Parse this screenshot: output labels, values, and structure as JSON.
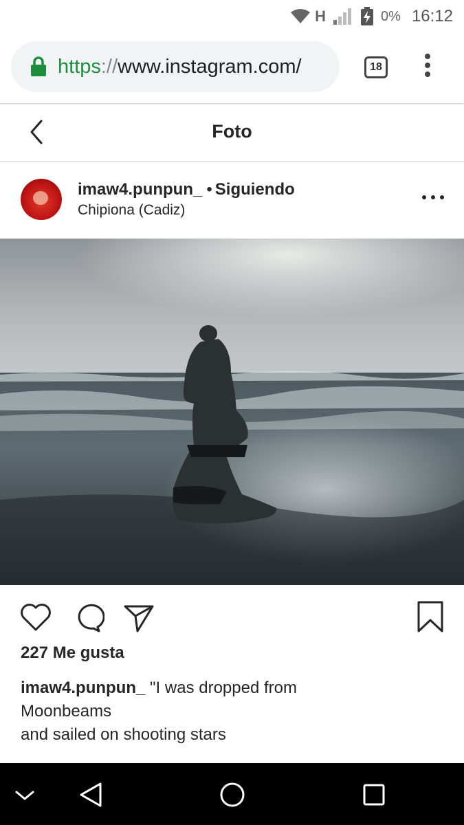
{
  "status_bar": {
    "network": "H",
    "battery": "0%",
    "time": "16:12",
    "icons": [
      "wifi-icon",
      "signal-icon",
      "battery-charging-icon"
    ]
  },
  "browser": {
    "url_scheme": "https",
    "url_sep": "://",
    "url_rest": "www.instagram.com/",
    "tab_count": "18",
    "icons": [
      "lock-icon",
      "overflow-menu-icon"
    ]
  },
  "page": {
    "title": "Foto"
  },
  "post": {
    "username": "imaw4.punpun_",
    "dot": "•",
    "follow_status": "Siguiendo",
    "location": "Chipiona (Cadiz)",
    "likes": "227 Me gusta",
    "caption_username": "imaw4.punpun_",
    "caption_line1": " \"I was dropped from",
    "caption_line2": "Moonbeams",
    "caption_line3": "and sailed on shooting stars"
  },
  "colors": {
    "secure_green": "#1e8e3e",
    "text": "#262626",
    "navbar": "#000000"
  }
}
